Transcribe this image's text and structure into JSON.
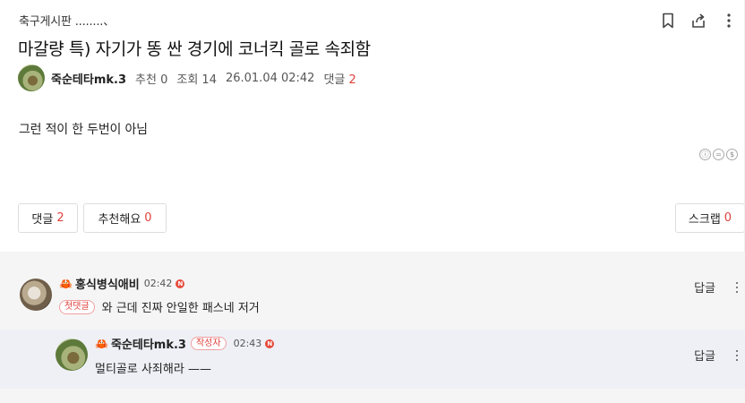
{
  "breadcrumb": "축구게시판 ........、",
  "post": {
    "title": "마갈량 특) 자기가 똥 싼 경기에 코너킥 골로 속죄함",
    "author": "죽순테타mk.3",
    "recommend_label": "추천",
    "recommend_count": "0",
    "views_label": "조회",
    "views_count": "14",
    "datetime": "26.01.04 02:42",
    "comments_label": "댓글",
    "comments_count": "2",
    "body": "그런 적이 한 두번이 아님"
  },
  "license_icons": [
    "ⓘ",
    "=",
    "$"
  ],
  "icons": {
    "bookmark": "bookmark-icon",
    "share": "share-icon",
    "more": "more-vertical-icon"
  },
  "buttons": {
    "comments_label": "댓글",
    "comments_count": "2",
    "recommend_label": "추천해요",
    "recommend_count": "0",
    "scrap_label": "스크랩",
    "scrap_count": "0"
  },
  "comments": [
    {
      "author": "홍식병식애비",
      "time": "02:42",
      "new_badge": "N",
      "first_badge": "첫댓글",
      "text": "와 근데 진짜 안일한 패스네 저거",
      "reply_label": "답글"
    },
    {
      "author": "죽순테타mk.3",
      "writer_badge": "작성자",
      "time": "02:43",
      "new_badge": "N",
      "text": "멀티골로 사죄해라 ——",
      "reply_label": "답글"
    }
  ],
  "colors": {
    "accent_red": "#e0413d",
    "comment_bg": "#f5f5f5",
    "reply_bg": "#eef0f6"
  }
}
